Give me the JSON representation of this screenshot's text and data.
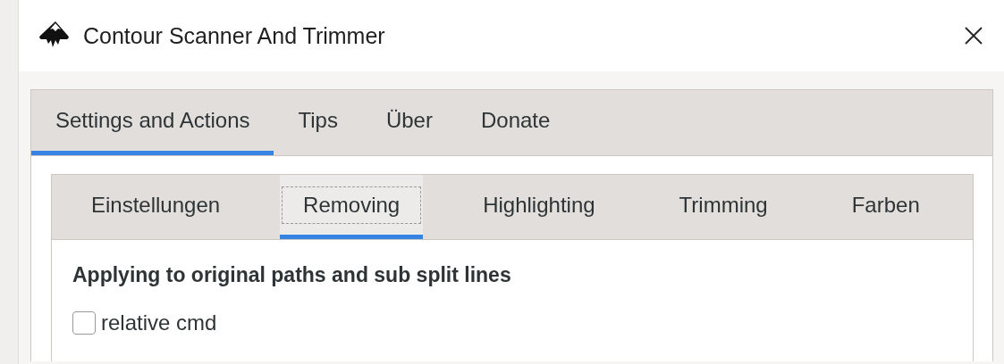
{
  "window": {
    "title": "Contour Scanner And Trimmer"
  },
  "tabs": [
    {
      "label": "Settings and Actions",
      "selected": true
    },
    {
      "label": "Tips",
      "selected": false
    },
    {
      "label": "Über",
      "selected": false
    },
    {
      "label": "Donate",
      "selected": false
    }
  ],
  "subtabs": [
    {
      "label": "Einstellungen",
      "selected": false,
      "focused": false
    },
    {
      "label": "Removing",
      "selected": true,
      "focused": true
    },
    {
      "label": "Highlighting",
      "selected": false,
      "focused": false
    },
    {
      "label": "Trimming",
      "selected": false,
      "focused": false
    },
    {
      "label": "Farben",
      "selected": false,
      "focused": false
    }
  ],
  "section": {
    "heading": "Applying to original paths and sub split lines",
    "options": [
      {
        "label": "relative cmd",
        "checked": false
      }
    ]
  }
}
